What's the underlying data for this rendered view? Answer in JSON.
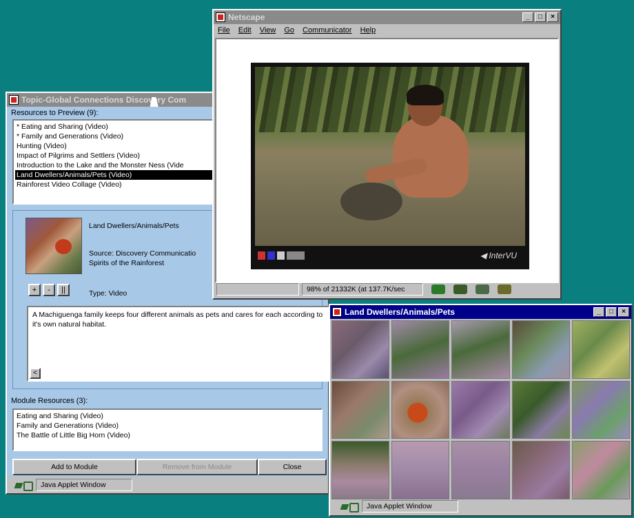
{
  "topic_window": {
    "title": "Topic-Global Connections    Discovery Com",
    "preview_label": "Resources to Preview (9):",
    "preview_items": [
      "* Eating and Sharing (Video)",
      "* Family and Generations (Video)",
      "Hunting (Video)",
      "Impact of Pilgrims and Settlers (Video)",
      "Introduction to the Lake and the Monster Ness (Vide",
      "Land Dwellers/Animals/Pets (Video)",
      "Rainforest Video Collage (Video)"
    ],
    "selected_index": 5,
    "detail": {
      "name": "Land Dwellers/Animals/Pets",
      "source": "Source: Discovery Communicatio",
      "program": "Spirits of the Rainforest",
      "type": "Type: Video",
      "buttons": [
        "+",
        "-",
        "||"
      ],
      "description": "A Machiguenga family keeps four different animals as pets and cares for each according to it's own natural habitat.",
      "scroll_glyph": "<"
    },
    "module_label": "Module Resources (3):",
    "module_items": [
      "Eating and Sharing (Video)",
      "Family and Generations (Video)",
      "The Battle of Little Big Horn (Video)"
    ],
    "buttons": {
      "add": "Add to Module",
      "remove": "Remove from Module",
      "close": "Close"
    },
    "status": "Java Applet Window"
  },
  "netscape_window": {
    "title": "Netscape",
    "menu": [
      "File",
      "Edit",
      "View",
      "Go",
      "Communicator",
      "Help"
    ],
    "video_logo": "◀ InterVU",
    "status_text": "98% of 21332K (at 137.7K/sec",
    "status_icons": [
      "leaf-icon",
      "ship-icon",
      "mail-icon",
      "edit-icon"
    ]
  },
  "land_window": {
    "title": "Land Dwellers/Animals/Pets",
    "status": "Java Applet Window"
  },
  "title_buttons": [
    "_",
    "□",
    "×"
  ],
  "colors": {
    "desktop": "#0a7f80",
    "active_title": "#00008b",
    "panel_blue": "#a8c8e8",
    "window_gray": "#c0c0c0"
  }
}
